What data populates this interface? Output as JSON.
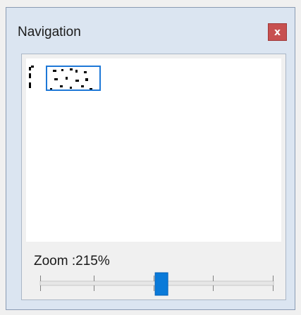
{
  "window": {
    "title": "Navigation",
    "close_label": "x"
  },
  "zoom": {
    "label": "Zoom :215%",
    "slider_level": 0.52
  },
  "icons": {
    "close": "close-icon"
  },
  "colors": {
    "accent": "#1e78d7",
    "close_button": "#c75050",
    "window_frame": "#dbe5f1"
  }
}
